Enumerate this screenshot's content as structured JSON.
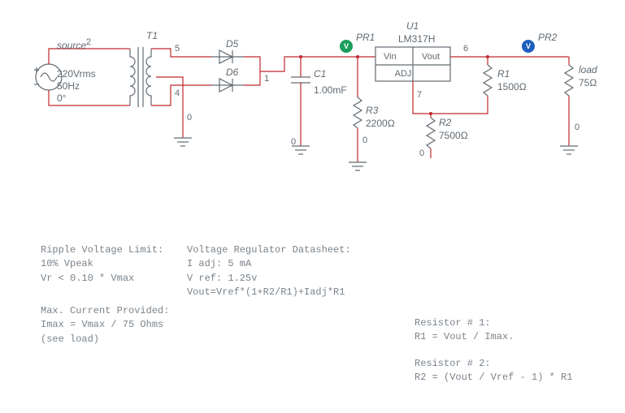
{
  "source": {
    "ref": "source",
    "voltage": "220Vrms",
    "freq": "50Hz",
    "phase": "0°",
    "node_top": "2"
  },
  "transformer": {
    "ref": "T1",
    "node_sec_top": "5",
    "node_sec_bot": "4",
    "node_ct": "0"
  },
  "diodes": {
    "d5": "D5",
    "d6": "D6",
    "node_out": "1"
  },
  "cap": {
    "ref": "C1",
    "value": "1.00mF",
    "node_bot": "0"
  },
  "r3": {
    "ref": "R3",
    "value": "2200Ω",
    "node_bot": "0"
  },
  "reg": {
    "ref": "U1",
    "part": "LM317H",
    "pin_in": "Vin",
    "pin_out": "Vout",
    "pin_adj": "ADJ",
    "node_out": "6",
    "node_adj": "7"
  },
  "r2": {
    "ref": "R2",
    "value": "7500Ω",
    "node_bot": "0"
  },
  "r1": {
    "ref": "R1",
    "value": "1500Ω"
  },
  "load": {
    "ref": "load",
    "value": "75Ω",
    "node_bot": "0"
  },
  "probes": {
    "pr1": "PR1",
    "pr2": "PR2",
    "glyph": "V"
  },
  "notes": {
    "ripple_h": "Ripple Voltage Limit:",
    "ripple_1": "10% Vpeak",
    "ripple_2": "Vr < 0.10 * Vmax",
    "imax_h": "Max. Current Provided:",
    "imax_1": "Imax = Vmax / 75 Ohms",
    "imax_2": "(see load)",
    "ds_h": "Voltage Regulator Datasheet:",
    "ds_1": "I adj: 5 mA",
    "ds_2": "V ref: 1.25v",
    "ds_3": "Vout=Vref*(1+R2/R1)+Iadj*R1",
    "r1_h": "Resistor # 1:",
    "r1_f": "R1 = Vout / Imax.",
    "r2_h": "Resistor # 2:",
    "r2_f": "R2 = (Vout / Vref - 1) * R1"
  }
}
